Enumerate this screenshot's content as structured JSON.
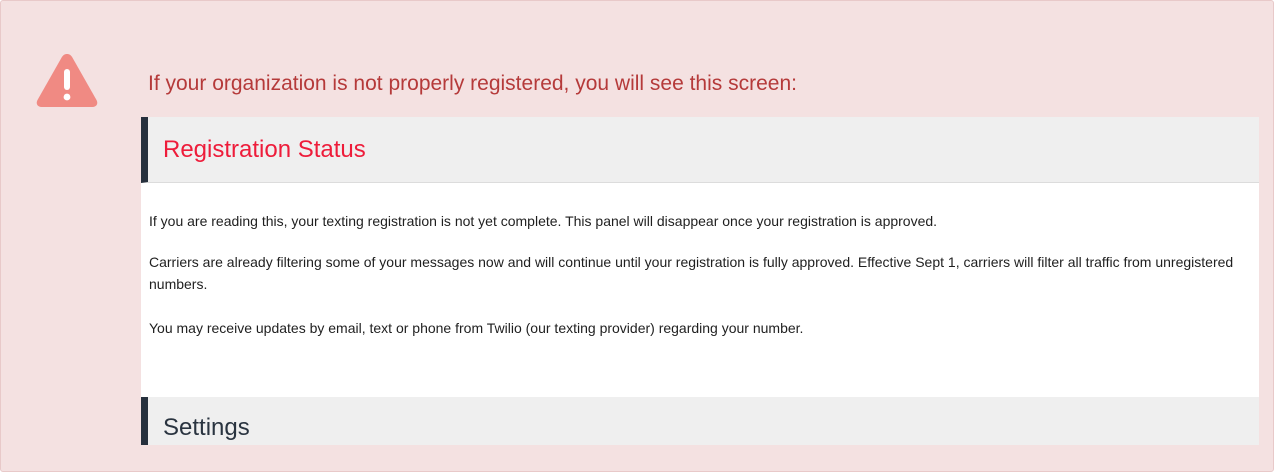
{
  "callout": {
    "icon": "warning-triangle-icon",
    "icon_color": "#f08a83",
    "text": "If your organization is not properly registered, you will see this screen:",
    "text_color": "#b53a3a",
    "background": "#f4e1e1"
  },
  "screenshot": {
    "registration_title": "Registration Status",
    "registration_title_color": "#ee1c3a",
    "paragraphs": [
      "If you are reading this, your texting registration is not yet complete. This panel will disappear once your registration is approved.",
      "Carriers are already filtering some of your messages now and will continue until your registration is fully approved. Effective Sept 1, carriers will filter all traffic from unregistered numbers.",
      "You may receive updates by email, text or phone from Twilio (our texting provider) regarding your number."
    ],
    "settings_title": "Settings"
  }
}
